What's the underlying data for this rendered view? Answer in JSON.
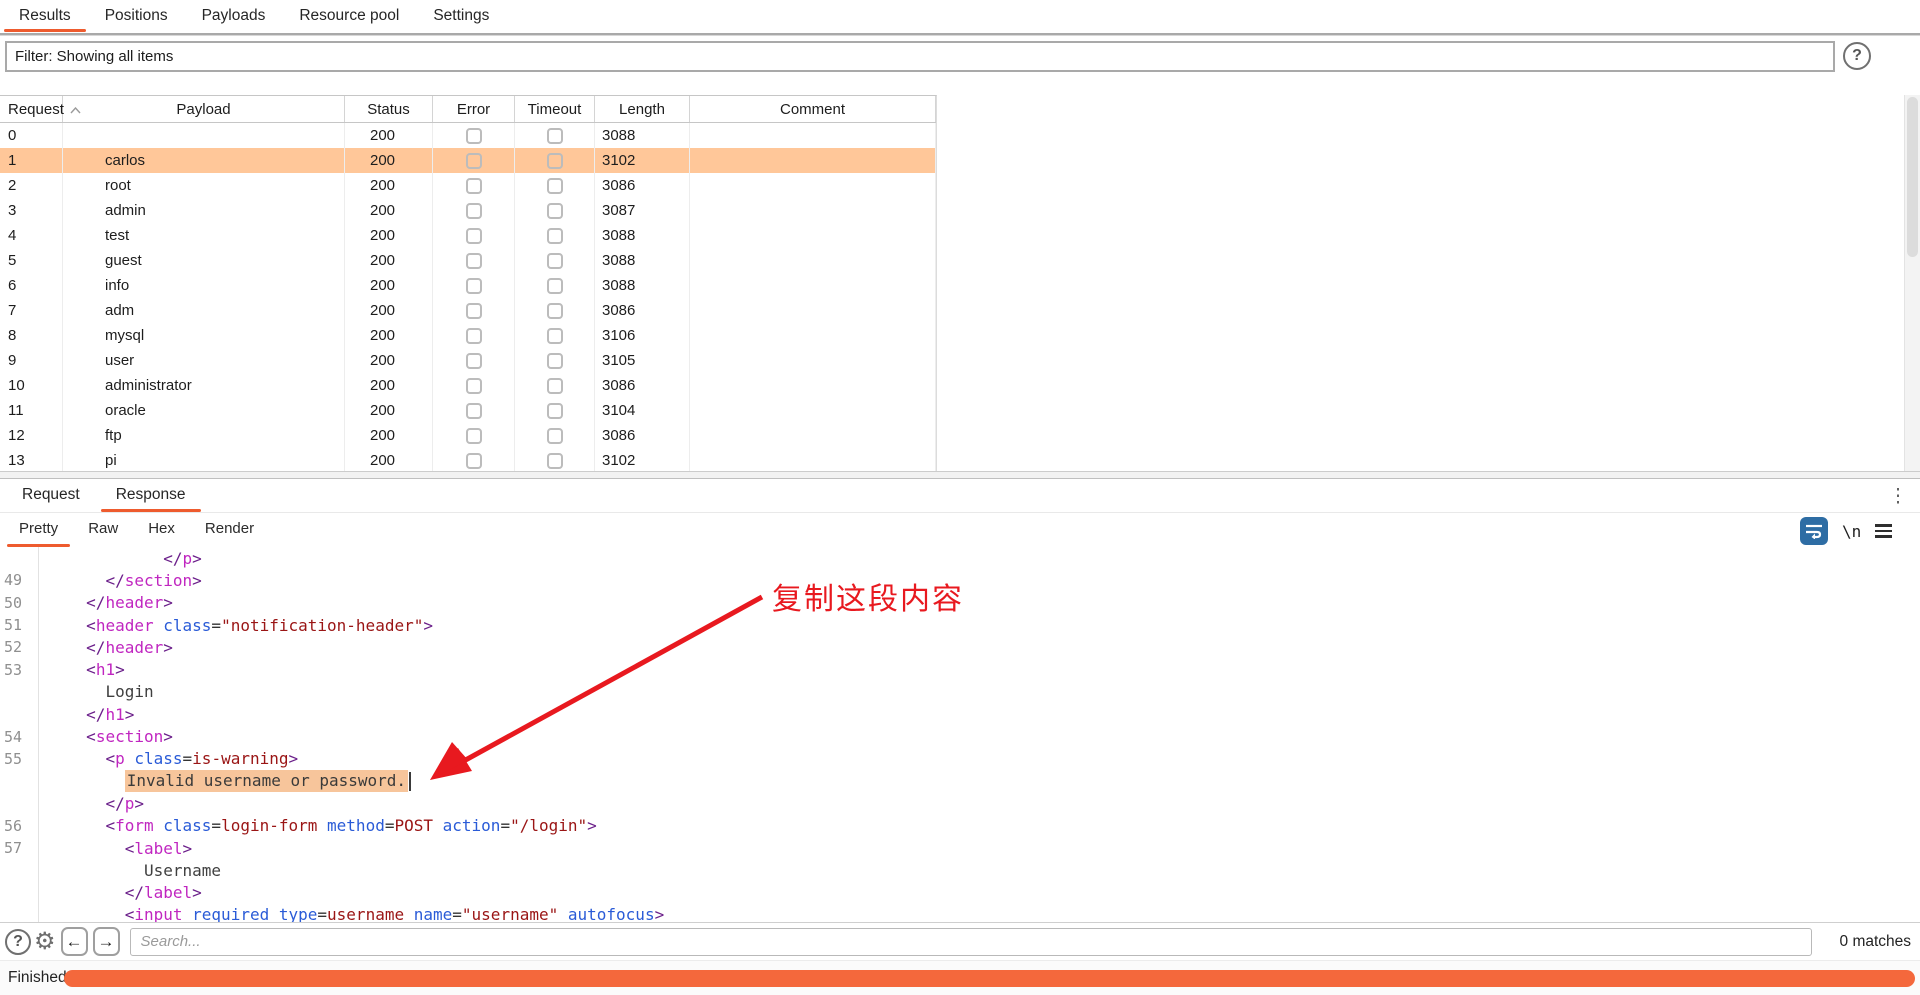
{
  "colors": {
    "accent_orange": "#ee5b2e",
    "progress_orange": "#f4683c",
    "row_selected": "#ffc799",
    "code_highlight": "#f7c59b",
    "annotation_red": "#e8191f",
    "icon_blue": "#2e6da4"
  },
  "top_tabs": {
    "items": [
      "Results",
      "Positions",
      "Payloads",
      "Resource pool",
      "Settings"
    ],
    "active": "Results"
  },
  "filter_bar": {
    "text": "Filter: Showing all items",
    "help_icon": "question-mark-icon"
  },
  "results_table": {
    "columns": [
      "Request",
      "Payload",
      "Status",
      "Error",
      "Timeout",
      "Length",
      "Comment"
    ],
    "sorted_column": "Request",
    "rows": [
      {
        "request": "0",
        "payload": "",
        "status": "200",
        "error": false,
        "timeout": false,
        "length": "3088",
        "comment": "",
        "selected": false
      },
      {
        "request": "1",
        "payload": "carlos",
        "status": "200",
        "error": false,
        "timeout": false,
        "length": "3102",
        "comment": "",
        "selected": true
      },
      {
        "request": "2",
        "payload": "root",
        "status": "200",
        "error": false,
        "timeout": false,
        "length": "3086",
        "comment": "",
        "selected": false
      },
      {
        "request": "3",
        "payload": "admin",
        "status": "200",
        "error": false,
        "timeout": false,
        "length": "3087",
        "comment": "",
        "selected": false
      },
      {
        "request": "4",
        "payload": "test",
        "status": "200",
        "error": false,
        "timeout": false,
        "length": "3088",
        "comment": "",
        "selected": false
      },
      {
        "request": "5",
        "payload": "guest",
        "status": "200",
        "error": false,
        "timeout": false,
        "length": "3088",
        "comment": "",
        "selected": false
      },
      {
        "request": "6",
        "payload": "info",
        "status": "200",
        "error": false,
        "timeout": false,
        "length": "3088",
        "comment": "",
        "selected": false
      },
      {
        "request": "7",
        "payload": "adm",
        "status": "200",
        "error": false,
        "timeout": false,
        "length": "3086",
        "comment": "",
        "selected": false
      },
      {
        "request": "8",
        "payload": "mysql",
        "status": "200",
        "error": false,
        "timeout": false,
        "length": "3106",
        "comment": "",
        "selected": false
      },
      {
        "request": "9",
        "payload": "user",
        "status": "200",
        "error": false,
        "timeout": false,
        "length": "3105",
        "comment": "",
        "selected": false
      },
      {
        "request": "10",
        "payload": "administrator",
        "status": "200",
        "error": false,
        "timeout": false,
        "length": "3086",
        "comment": "",
        "selected": false
      },
      {
        "request": "11",
        "payload": "oracle",
        "status": "200",
        "error": false,
        "timeout": false,
        "length": "3104",
        "comment": "",
        "selected": false
      },
      {
        "request": "12",
        "payload": "ftp",
        "status": "200",
        "error": false,
        "timeout": false,
        "length": "3086",
        "comment": "",
        "selected": false
      },
      {
        "request": "13",
        "payload": "pi",
        "status": "200",
        "error": false,
        "timeout": false,
        "length": "3102",
        "comment": "",
        "selected": false
      }
    ]
  },
  "editor": {
    "tabs": [
      "Request",
      "Response"
    ],
    "active_tab": "Response",
    "view_tabs": [
      "Pretty",
      "Raw",
      "Hex",
      "Render"
    ],
    "active_view": "Pretty",
    "toolbar": {
      "newline_label": "\\n"
    },
    "code_lines": [
      {
        "num": "",
        "indent": 13,
        "tokens": [
          [
            "b",
            "</"
          ],
          [
            "t",
            "p"
          ],
          [
            "b",
            ">"
          ]
        ]
      },
      {
        "num": "49",
        "indent": 7,
        "tokens": [
          [
            "b",
            "</"
          ],
          [
            "t",
            "section"
          ],
          [
            "b",
            ">"
          ]
        ]
      },
      {
        "num": "50",
        "indent": 5,
        "tokens": [
          [
            "b",
            "</"
          ],
          [
            "t",
            "header"
          ],
          [
            "b",
            ">"
          ]
        ]
      },
      {
        "num": "51",
        "indent": 5,
        "tokens": [
          [
            "b",
            "<"
          ],
          [
            "t",
            "header"
          ],
          [
            "p",
            " "
          ],
          [
            "a",
            "class"
          ],
          [
            "e",
            "="
          ],
          [
            "v",
            "\"notification-header\""
          ],
          [
            "b",
            ">"
          ]
        ]
      },
      {
        "num": "52",
        "indent": 5,
        "tokens": [
          [
            "b",
            "</"
          ],
          [
            "t",
            "header"
          ],
          [
            "b",
            ">"
          ]
        ]
      },
      {
        "num": "53",
        "indent": 5,
        "tokens": [
          [
            "b",
            "<"
          ],
          [
            "t",
            "h1"
          ],
          [
            "b",
            ">"
          ]
        ]
      },
      {
        "num": "",
        "indent": 7,
        "tokens": [
          [
            "x",
            "Login"
          ]
        ]
      },
      {
        "num": "",
        "indent": 5,
        "tokens": [
          [
            "b",
            "</"
          ],
          [
            "t",
            "h1"
          ],
          [
            "b",
            ">"
          ]
        ]
      },
      {
        "num": "54",
        "indent": 5,
        "tokens": [
          [
            "b",
            "<"
          ],
          [
            "t",
            "section"
          ],
          [
            "b",
            ">"
          ]
        ]
      },
      {
        "num": "55",
        "indent": 7,
        "tokens": [
          [
            "b",
            "<"
          ],
          [
            "t",
            "p"
          ],
          [
            "p",
            " "
          ],
          [
            "a",
            "class"
          ],
          [
            "e",
            "="
          ],
          [
            "v",
            "is-warning"
          ],
          [
            "b",
            ">"
          ]
        ]
      },
      {
        "num": "",
        "indent": 9,
        "tokens": [
          [
            "h",
            "Invalid username or password."
          ]
        ],
        "cursor": true
      },
      {
        "num": "",
        "indent": 7,
        "tokens": [
          [
            "b",
            "</"
          ],
          [
            "t",
            "p"
          ],
          [
            "b",
            ">"
          ]
        ]
      },
      {
        "num": "56",
        "indent": 7,
        "tokens": [
          [
            "b",
            "<"
          ],
          [
            "t",
            "form"
          ],
          [
            "p",
            " "
          ],
          [
            "a",
            "class"
          ],
          [
            "e",
            "="
          ],
          [
            "v",
            "login-form"
          ],
          [
            "p",
            " "
          ],
          [
            "a",
            "method"
          ],
          [
            "e",
            "="
          ],
          [
            "v",
            "POST"
          ],
          [
            "p",
            " "
          ],
          [
            "a",
            "action"
          ],
          [
            "e",
            "="
          ],
          [
            "v",
            "\"/login\""
          ],
          [
            "b",
            ">"
          ]
        ]
      },
      {
        "num": "57",
        "indent": 9,
        "tokens": [
          [
            "b",
            "<"
          ],
          [
            "t",
            "label"
          ],
          [
            "b",
            ">"
          ]
        ]
      },
      {
        "num": "",
        "indent": 11,
        "tokens": [
          [
            "x",
            "Username"
          ]
        ]
      },
      {
        "num": "",
        "indent": 9,
        "tokens": [
          [
            "b",
            "</"
          ],
          [
            "t",
            "label"
          ],
          [
            "b",
            ">"
          ]
        ]
      },
      {
        "num": "",
        "indent": 9,
        "tokens": [
          [
            "b",
            "<"
          ],
          [
            "t",
            "input"
          ],
          [
            "p",
            " "
          ],
          [
            "a",
            "required"
          ],
          [
            "p",
            " "
          ],
          [
            "a",
            "type"
          ],
          [
            "e",
            "="
          ],
          [
            "v",
            "username"
          ],
          [
            "p",
            " "
          ],
          [
            "a",
            "name"
          ],
          [
            "e",
            "="
          ],
          [
            "v",
            "\"username\""
          ],
          [
            "p",
            " "
          ],
          [
            "a",
            "autofocus"
          ],
          [
            "b",
            ">"
          ]
        ]
      }
    ]
  },
  "annotation": {
    "label": "复制这段内容"
  },
  "search_bar": {
    "placeholder": "Search...",
    "matches": "0 matches"
  },
  "status_bar": {
    "label": "Finished"
  }
}
